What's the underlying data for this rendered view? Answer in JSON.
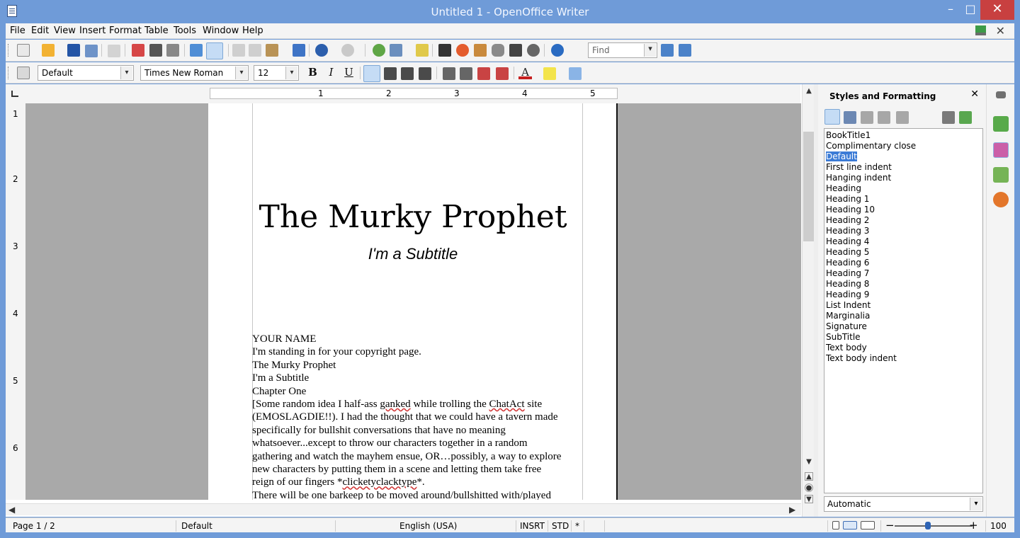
{
  "window": {
    "title": "Untitled 1 - OpenOffice Writer",
    "min_symbol": "–",
    "max_symbol": "□",
    "close_symbol": "✕"
  },
  "menu": {
    "items": [
      "File",
      "Edit",
      "View",
      "Insert",
      "Format",
      "Table",
      "Tools",
      "Window",
      "Help"
    ],
    "close_doc_symbol": "✕"
  },
  "toolbar": {
    "find_placeholder": "Find",
    "dropdown_symbol": "▾"
  },
  "formatting": {
    "paragraph_style": "Default",
    "font_name": "Times New Roman",
    "font_size": "12",
    "bold": "B",
    "italic": "I",
    "underline": "U",
    "font_color": "A"
  },
  "ruler": {
    "labels": [
      "1",
      "2",
      "3",
      "4",
      "5"
    ],
    "vertical_labels": [
      "1",
      "2",
      "3",
      "4",
      "5",
      "6"
    ]
  },
  "document": {
    "title": "The Murky Prophet",
    "subtitle": "I'm a Subtitle",
    "lines": [
      "YOUR NAME",
      "I'm standing in for your copyright page.",
      "The Murky Prophet",
      "I'm a Subtitle",
      "Chapter One"
    ],
    "paragraph": {
      "l1a": "[Some random idea I half-ass ",
      "l1b": "ganked",
      "l1c": " while trolling the ",
      "l1d": "ChatAct",
      "l1e": " site",
      "l2": "(EMOSLAGDIE!!). I had the thought that we could have a tavern made",
      "l3": "specifically for bullshit conversations that have no meaning",
      "l4": "whatsoever...except to throw our characters together in a random",
      "l5": "gathering and watch the mayhem ensue, OR…possibly, a way to explore",
      "l6": "new characters by putting them in a scene and letting them take free",
      "l7a": "reign of our fingers *",
      "l7b": "clicketyclacktype",
      "l7c": "*.",
      "l8": "There will be one barkeep to be moved around/bullshitted with/played"
    }
  },
  "styles_panel": {
    "title": "Styles and Formatting",
    "close_symbol": "✕",
    "styles": [
      "BookTitle1",
      "Complimentary close",
      "Default",
      "First line indent",
      "Hanging indent",
      "Heading",
      "Heading 1",
      "Heading 10",
      "Heading 2",
      "Heading 3",
      "Heading 4",
      "Heading 5",
      "Heading 6",
      "Heading 7",
      "Heading 8",
      "Heading 9",
      "List Indent",
      "Marginalia",
      "Signature",
      "SubTitle",
      "Text body",
      "Text body indent"
    ],
    "selected_style": "Default",
    "filter": "Automatic"
  },
  "status": {
    "page": "Page 1 / 2",
    "page_style": "Default",
    "language": "English (USA)",
    "insert_mode": "INSRT",
    "selection_mode": "STD",
    "modified": "*",
    "zoom_minus": "−",
    "zoom_plus": "+",
    "zoom": "100 %"
  },
  "colors": {
    "titlebar": "#6f9bd8",
    "close_button": "#c84040",
    "selection": "#3b7bd6",
    "page_background": "#a9a9a9"
  },
  "icons": [
    "app-icon",
    "new-document-icon",
    "open-folder-icon",
    "save-icon",
    "email-icon",
    "edit-file-icon",
    "export-pdf-icon",
    "print-icon",
    "print-preview-icon",
    "spelling-icon",
    "autospellcheck-icon",
    "cut-icon",
    "copy-icon",
    "paste-icon",
    "clone-format-icon",
    "undo-icon",
    "redo-icon",
    "hyperlink-icon",
    "table-icon",
    "draw-functions-icon",
    "find-replace-icon",
    "navigator-icon",
    "gallery-icon",
    "data-sources-icon",
    "nonprinting-characters-icon",
    "zoom-icon",
    "help-icon",
    "find-down-icon",
    "find-up-icon",
    "styles-icon",
    "align-left-icon",
    "align-center-icon",
    "align-right-icon",
    "justify-icon",
    "numbering-icon",
    "bullets-icon",
    "decrease-indent-icon",
    "increase-indent-icon",
    "font-color-icon",
    "highlight-icon",
    "background-color-icon",
    "paragraph-styles-icon",
    "character-styles-icon",
    "frame-styles-icon",
    "page-styles-icon",
    "list-styles-icon",
    "fill-format-icon",
    "new-style-icon",
    "properties-icon",
    "sidebar-styles-icon",
    "gallery-dock-icon",
    "navigator-dock-icon",
    "single-page-icon",
    "multi-page-icon",
    "book-view-icon"
  ]
}
